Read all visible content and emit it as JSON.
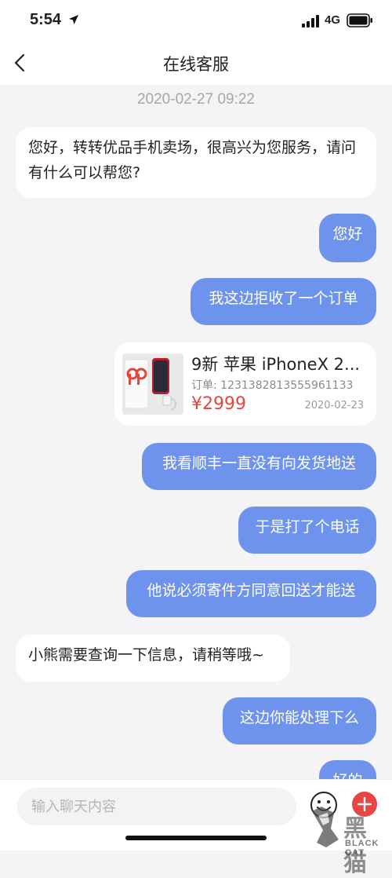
{
  "status": {
    "time": "5:54",
    "network": "4G"
  },
  "nav": {
    "title": "在线客服"
  },
  "conversation": {
    "timestamp": "2020-02-27 09:22",
    "messages": [
      {
        "from": "agent",
        "text": "您好，转转优品手机卖场，很高兴为您服务，请问有什么可以帮您?"
      },
      {
        "from": "user",
        "text": "您好"
      },
      {
        "from": "user",
        "text": "我这边拒收了一个订单"
      },
      {
        "from": "user",
        "text": "我看顺丰一直没有向发货地送"
      },
      {
        "from": "user",
        "text": "于是打了个电话"
      },
      {
        "from": "user",
        "text": "他说必须寄件方同意回送才能送"
      },
      {
        "from": "agent",
        "text": "小熊需要查询一下信息，请稍等哦~"
      },
      {
        "from": "user",
        "text": "这边你能处理下么"
      },
      {
        "from": "user",
        "text": "好的"
      }
    ],
    "order_card": {
      "title": "9新 苹果 iPhoneX 2...",
      "order_number": "订单: 1231382813555961133",
      "price": "¥2999",
      "date": "2020-02-23"
    }
  },
  "input": {
    "placeholder": "输入聊天内容"
  },
  "watermark": {
    "text": "黑猫",
    "sub": "BLACK CAT"
  },
  "colors": {
    "user_bubble": "#6e93ec",
    "price": "#e5453d",
    "add_button": "#e84545"
  }
}
